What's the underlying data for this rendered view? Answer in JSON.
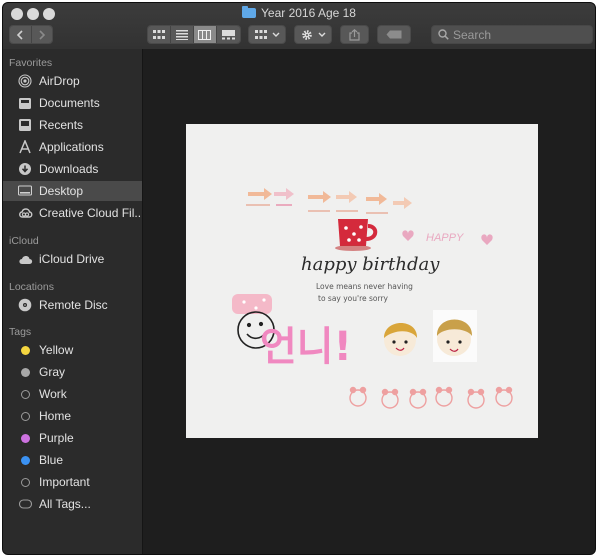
{
  "window": {
    "title": "Year 2016 Age 18"
  },
  "toolbar": {
    "back": "back",
    "forward": "forward",
    "view_modes": [
      "icon-view",
      "list-view",
      "column-view",
      "gallery-view"
    ],
    "active_view": "column-view",
    "group_button": "group",
    "action_button": "action",
    "share_button": "share",
    "tag_button": "tag"
  },
  "search": {
    "placeholder": "Search"
  },
  "sidebar": {
    "favorites_header": "Favorites",
    "favorites": [
      {
        "label": "AirDrop",
        "icon": "airdrop-icon"
      },
      {
        "label": "Documents",
        "icon": "documents-icon"
      },
      {
        "label": "Recents",
        "icon": "recents-icon"
      },
      {
        "label": "Applications",
        "icon": "applications-icon"
      },
      {
        "label": "Downloads",
        "icon": "downloads-icon"
      },
      {
        "label": "Desktop",
        "icon": "desktop-icon",
        "selected": true
      },
      {
        "label": "Creative Cloud Fil...",
        "icon": "creative-cloud-icon"
      }
    ],
    "icloud_header": "iCloud",
    "icloud": [
      {
        "label": "iCloud Drive",
        "icon": "cloud-icon"
      }
    ],
    "locations_header": "Locations",
    "locations": [
      {
        "label": "Remote Disc",
        "icon": "disc-icon"
      }
    ],
    "tags_header": "Tags",
    "tags": [
      {
        "label": "Yellow",
        "color": "#f5d640"
      },
      {
        "label": "Gray",
        "color": "#a8a8a8"
      },
      {
        "label": "Work",
        "color": "hollow"
      },
      {
        "label": "Home",
        "color": "hollow"
      },
      {
        "label": "Purple",
        "color": "#cd72e0"
      },
      {
        "label": "Blue",
        "color": "#3b92f3"
      },
      {
        "label": "Important",
        "color": "hollow"
      },
      {
        "label": "All Tags...",
        "color": "all-tags"
      }
    ]
  },
  "preview": {
    "happy_label": "HAPPY",
    "headline": "happy birthday",
    "subline_1": "Love means never having",
    "subline_2": "to say you're sorry",
    "korean": "언니!"
  }
}
